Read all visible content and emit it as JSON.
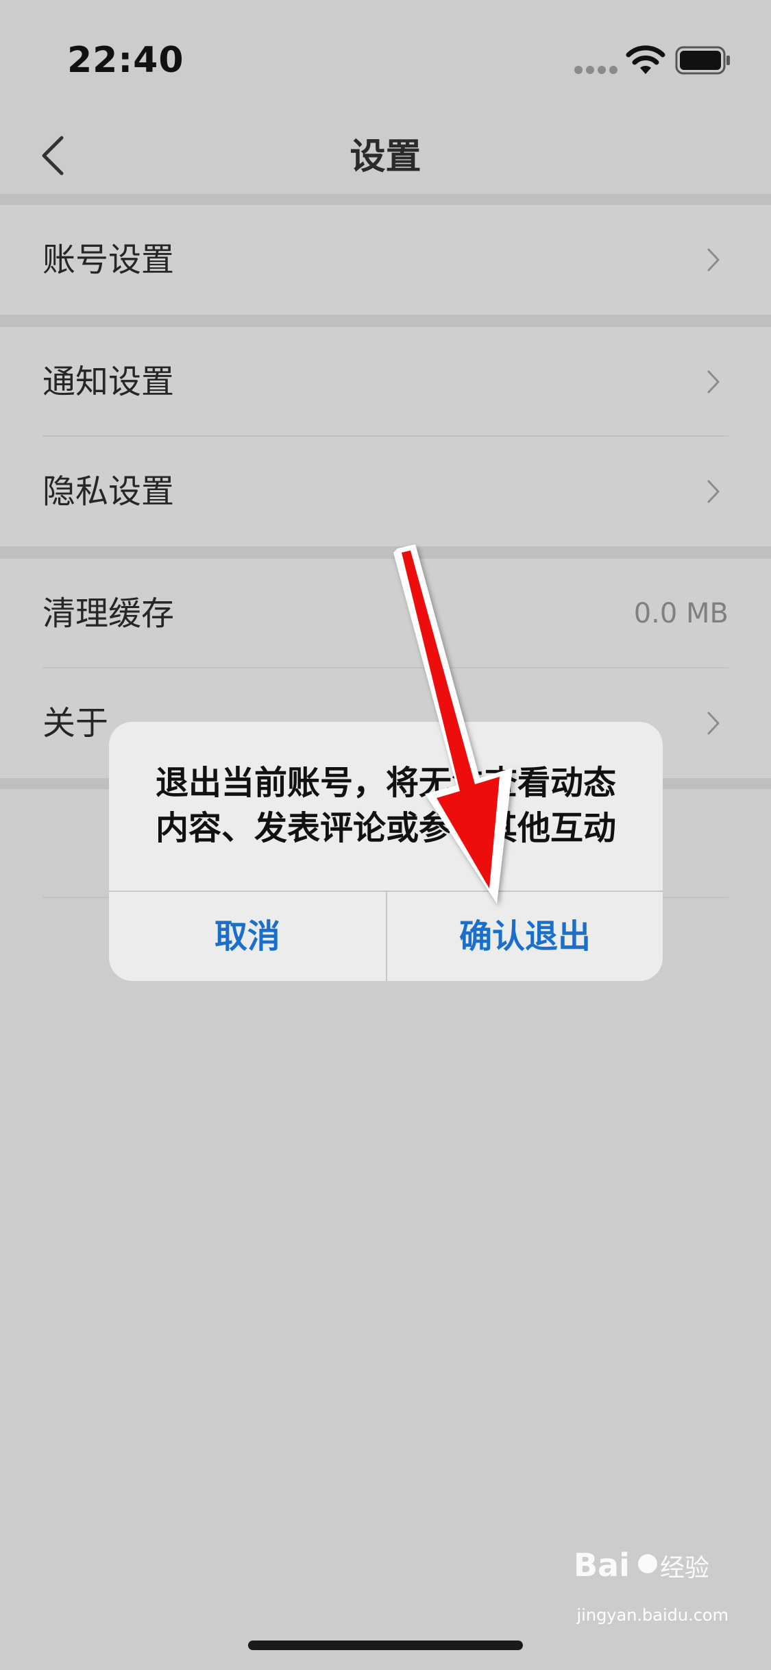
{
  "status_bar": {
    "time": "22:40",
    "icons": [
      "signal-dots-icon",
      "wifi-icon",
      "battery-icon"
    ]
  },
  "nav": {
    "back_icon": "chevron-left-icon",
    "title": "设置"
  },
  "settings": {
    "account": {
      "label": "账号设置"
    },
    "notification": {
      "label": "通知设置"
    },
    "privacy": {
      "label": "隐私设置"
    },
    "cache": {
      "label": "清理缓存",
      "value": "0.0 MB"
    },
    "about": {
      "label": "关于"
    }
  },
  "dialog": {
    "message": "退出当前账号，将无法查看动态内容、发表评论或参与其他互动",
    "cancel_label": "取消",
    "confirm_label": "确认退出"
  },
  "annotation": {
    "arrow_color": "#ee1111"
  },
  "watermark": {
    "brand": "Bai du 经验",
    "url": "jingyan.baidu.com"
  },
  "colors": {
    "accent": "#1a6fcc",
    "background": "#cccccc"
  }
}
